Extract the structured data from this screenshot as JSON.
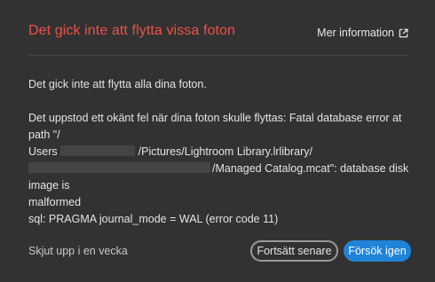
{
  "dialog": {
    "title": "Det gick inte att flytta vissa foton",
    "more_info_label": "Mer information",
    "more_info_icon": "external-link-icon",
    "title_color": "#ef5147",
    "accent_color": "#1f84d8"
  },
  "message": {
    "summary": "Det gick inte att flytta alla dina foton.",
    "detail_line1": "Det uppstod ett okänt fel när dina foton skulle flyttas: Fatal database error at path \"/",
    "detail_line2_prefix": "Users",
    "detail_line2_suffix": "/Pictures/Lightroom Library.lrlibrary/",
    "detail_line3_suffix": "/Managed Catalog.mcat\": database disk image is",
    "detail_line4": "malformed",
    "detail_line5": "sql: PRAGMA journal_mode = WAL (error code 11)"
  },
  "footer": {
    "snooze_label": "Skjut upp i en vecka",
    "later_label": "Fortsätt senare",
    "retry_label": "Försök igen"
  }
}
